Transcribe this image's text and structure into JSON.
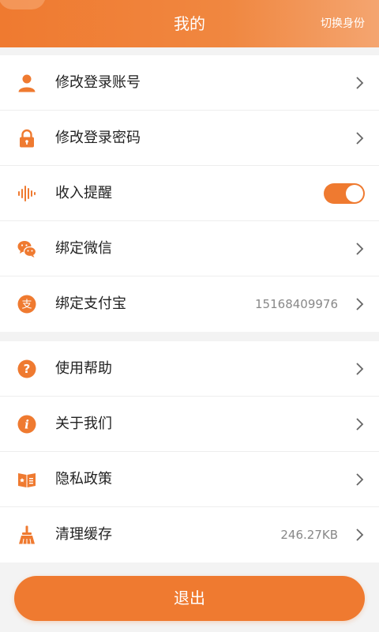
{
  "header": {
    "title": "我的",
    "switch_label": "切换身份"
  },
  "colors": {
    "accent": "#ef7a30",
    "background": "#f3f3f3",
    "text": "#222222",
    "muted": "#888888"
  },
  "account_group": [
    {
      "label": "修改登录账号",
      "icon": "user-icon"
    },
    {
      "label": "修改登录密码",
      "icon": "lock-icon"
    },
    {
      "label": "收入提醒",
      "icon": "sound-wave-icon",
      "toggle_on": true
    },
    {
      "label": "绑定微信",
      "icon": "wechat-icon"
    },
    {
      "label": "绑定支付宝",
      "icon": "alipay-icon",
      "value": "15168409976"
    }
  ],
  "info_group": [
    {
      "label": "使用帮助",
      "icon": "help-icon"
    },
    {
      "label": "关于我们",
      "icon": "info-icon"
    },
    {
      "label": "隐私政策",
      "icon": "privacy-icon"
    },
    {
      "label": "清理缓存",
      "icon": "broom-icon",
      "value": "246.27KB"
    }
  ],
  "logout_label": "退出"
}
